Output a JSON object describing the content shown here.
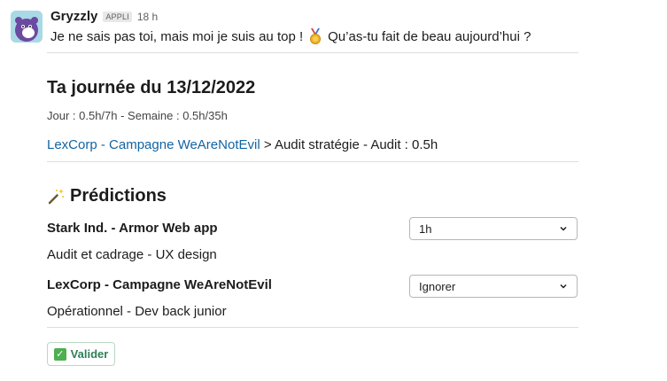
{
  "message": {
    "sender": "Gryzzly",
    "badge": "APPLI",
    "time": "18 h",
    "text_before": "Je ne sais pas toi, mais moi je suis au top !",
    "text_after": "Qu’as-tu fait de beau aujourd’hui ?"
  },
  "day": {
    "title": "Ta journée du 13/12/2022",
    "stats": "Jour : 0.5h/7h - Semaine : 0.5h/35h",
    "entry_link": "LexCorp - Campagne WeAreNotEvil",
    "entry_rest": " > Audit stratégie - Audit : 0.5h"
  },
  "predictions": {
    "title": "Prédictions",
    "items": [
      {
        "project": "Stark Ind. - Armor Web app",
        "task": "Audit et cadrage - UX design",
        "selected": "1h"
      },
      {
        "project": "LexCorp - Campagne WeAreNotEvil",
        "task": "Opérationnel - Dev back junior",
        "selected": "Ignorer"
      }
    ]
  },
  "actions": {
    "validate_label": "Valider"
  },
  "icons": {
    "avatar": "bear-avatar-icon",
    "medal": "medal-icon",
    "wand": "magic-wand-icon",
    "check": "check-icon"
  },
  "colors": {
    "link": "#1264a3",
    "validate_text": "#2f7f58",
    "check_bg": "#4caf50"
  }
}
